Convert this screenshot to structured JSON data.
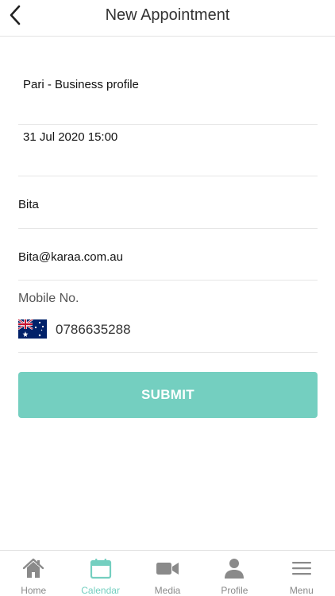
{
  "header": {
    "title": "New Appointment",
    "back_icon": "chevron-left-icon"
  },
  "form": {
    "business": "Pari - Business profile",
    "datetime": "31 Jul 2020 15:00",
    "name": "Bita",
    "email": "Bita@karaa.com.au",
    "mobile_label": "Mobile No.",
    "mobile_flag": "australia-flag-icon",
    "mobile_number": "0786635288"
  },
  "submit_label": "SUBMIT",
  "tabbar": {
    "active_color": "#74cfc0",
    "inactive_color": "#8a8a8a",
    "items": [
      {
        "label": "Home",
        "icon": "home-icon",
        "active": false
      },
      {
        "label": "Calendar",
        "icon": "calendar-icon",
        "active": true
      },
      {
        "label": "Media",
        "icon": "video-camera-icon",
        "active": false
      },
      {
        "label": "Profile",
        "icon": "person-icon",
        "active": false
      },
      {
        "label": "Menu",
        "icon": "hamburger-menu-icon",
        "active": false
      }
    ]
  },
  "colors": {
    "accent": "#74cfc0",
    "divider": "#e6e6e6"
  }
}
